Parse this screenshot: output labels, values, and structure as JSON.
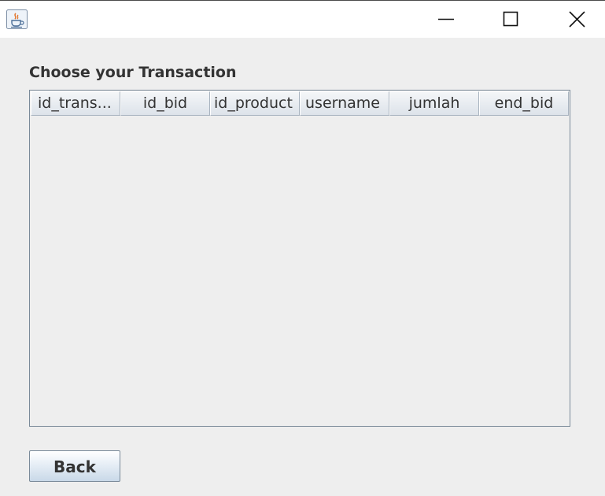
{
  "window": {
    "icon": "java-cup-icon",
    "controls": {
      "minimize_icon": "minimize-icon",
      "maximize_icon": "maximize-icon",
      "close_icon": "close-icon"
    }
  },
  "main": {
    "section_label": "Choose your Transaction",
    "table": {
      "columns": [
        "id_trans...",
        "id_bid",
        "id_product",
        "username",
        "jumlah",
        "end_bid"
      ],
      "rows": []
    },
    "back_button_label": "Back"
  }
}
